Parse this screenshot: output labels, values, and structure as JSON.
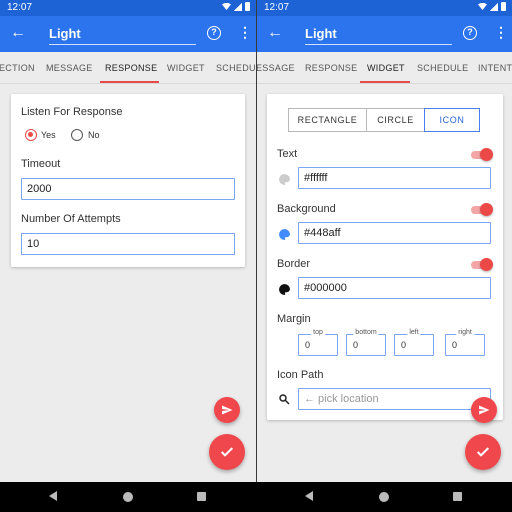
{
  "status_bar": {
    "time": "12:07"
  },
  "app_bar": {
    "title": "Light",
    "help_icon": "help-circle-icon",
    "more_icon": "more-vert-icon",
    "back_icon": "arrow-back-icon"
  },
  "left": {
    "tabs": [
      "ECTION",
      "MESSAGE",
      "RESPONSE",
      "WIDGET",
      "SCHEDULE"
    ],
    "active_tab": "RESPONSE",
    "listen_label": "Listen For Response",
    "radio_yes": "Yes",
    "radio_no": "No",
    "radio_selected": "Yes",
    "timeout_label": "Timeout",
    "timeout_value": "2000",
    "attempts_label": "Number Of Attempts",
    "attempts_value": "10"
  },
  "right": {
    "tabs": [
      "ESSAGE",
      "RESPONSE",
      "WIDGET",
      "SCHEDULE",
      "INTENT"
    ],
    "active_tab": "WIDGET",
    "shapes": [
      "RECTANGLE",
      "CIRCLE",
      "ICON"
    ],
    "active_shape": "ICON",
    "text_label": "Text",
    "text_color": "#ffffff",
    "background_label": "Background",
    "background_color": "#448aff",
    "border_label": "Border",
    "border_color": "#000000",
    "margin_label": "Margin",
    "margin": [
      {
        "caption": "top",
        "value": "0"
      },
      {
        "caption": "bottom",
        "value": "0"
      },
      {
        "caption": "left",
        "value": "0"
      },
      {
        "caption": "right",
        "value": "0"
      }
    ],
    "icon_path_label": "Icon Path",
    "icon_path_placeholder": "← pick location"
  },
  "colors": {
    "primary": "#2b74ee",
    "status": "#1e63d6",
    "accent": "#e84a4a",
    "fab": "#f0474c"
  }
}
